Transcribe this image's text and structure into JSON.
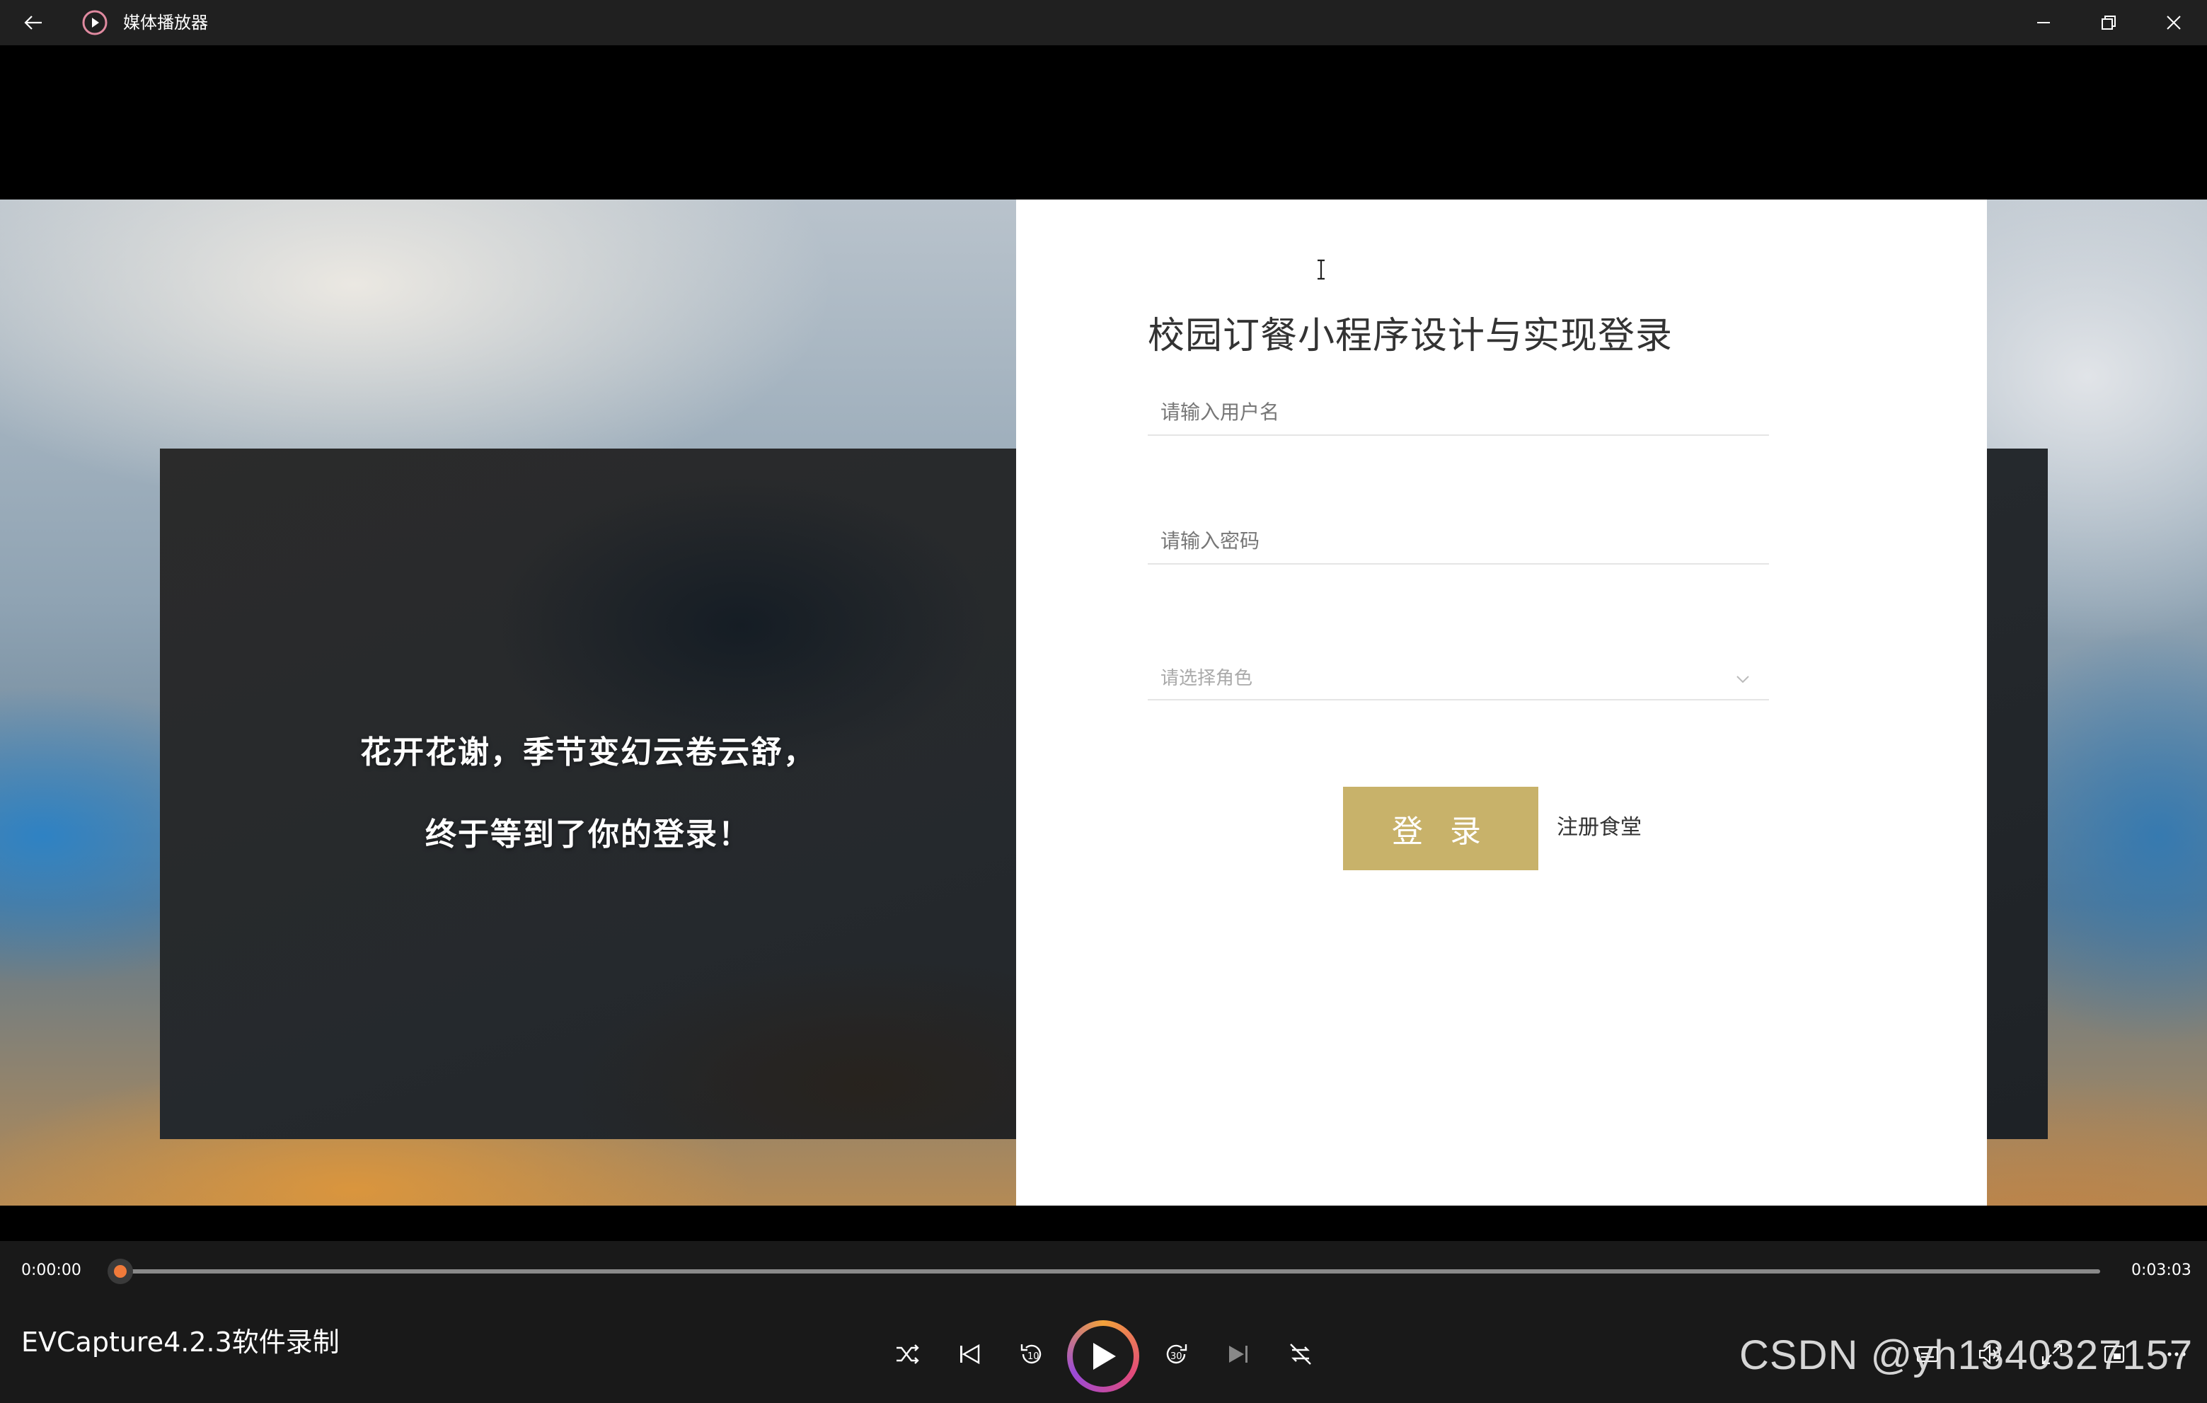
{
  "app": {
    "title": "媒体播放器"
  },
  "slide": {
    "quote_line1": "花开花谢，季节变幻云卷云舒，",
    "quote_line2": "终于等到了你的登录！"
  },
  "login": {
    "title": "校园订餐小程序设计与实现登录",
    "username_placeholder": "请输入用户名",
    "password_placeholder": "请输入密码",
    "role_placeholder": "请选择角色",
    "login_button": "登 录",
    "register_link": "注册食堂"
  },
  "player": {
    "current_time": "0:00:00",
    "total_time": "0:03:03",
    "progress": 0,
    "media_title": "EVCapture4.2.3软件录制",
    "watermark": "CSDN @yh1340327157"
  },
  "colors": {
    "accent": "#c8b26a",
    "seek_thumb": "#f07a3a"
  }
}
